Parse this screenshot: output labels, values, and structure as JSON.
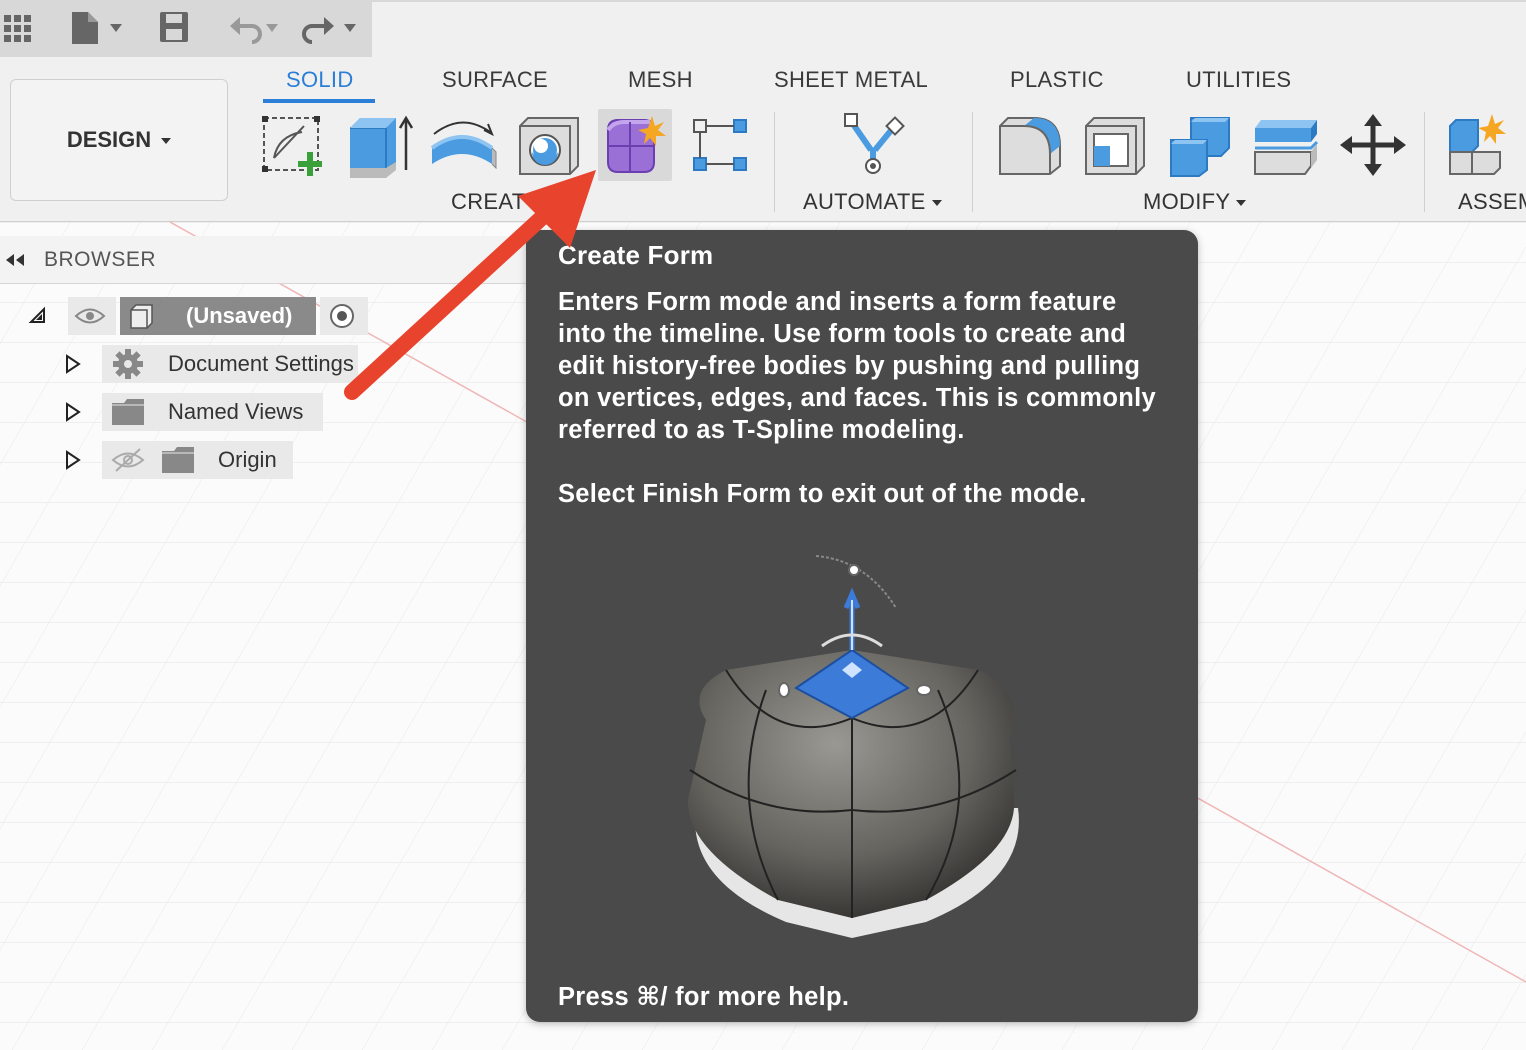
{
  "quick_access": {
    "icons": [
      "apps-grid-icon",
      "file-icon",
      "save-icon",
      "undo-icon",
      "redo-icon"
    ]
  },
  "workspace": {
    "label": "DESIGN"
  },
  "tabs": [
    {
      "label": "SOLID",
      "active": true
    },
    {
      "label": "SURFACE",
      "active": false
    },
    {
      "label": "MESH",
      "active": false
    },
    {
      "label": "SHEET METAL",
      "active": false
    },
    {
      "label": "PLASTIC",
      "active": false
    },
    {
      "label": "UTILITIES",
      "active": false
    }
  ],
  "groups": {
    "create": "CREAT",
    "automate": "AUTOMATE",
    "modify": "MODIFY",
    "assemble": "ASSEM"
  },
  "browser": {
    "title": "BROWSER",
    "root": "(Unsaved)",
    "items": [
      {
        "label": "Document Settings",
        "icon": "gear-icon"
      },
      {
        "label": "Named Views",
        "icon": "folder-icon"
      },
      {
        "label": "Origin",
        "icon": "folder-icon"
      }
    ]
  },
  "tooltip": {
    "title": "Create Form",
    "body": "Enters Form mode and inserts a form feature into the timeline. Use form tools to create and edit history-free bodies by pushing and pulling on vertices, edges, and faces.  This is commonly referred to as T-Spline modeling.",
    "body2": "Select Finish Form to exit out of the mode.",
    "footer": "Press ⌘/ for more help."
  },
  "colors": {
    "accent": "#2b7fd6",
    "annotation_arrow": "#e8432d",
    "tooltip_bg": "#4a4a4a"
  }
}
